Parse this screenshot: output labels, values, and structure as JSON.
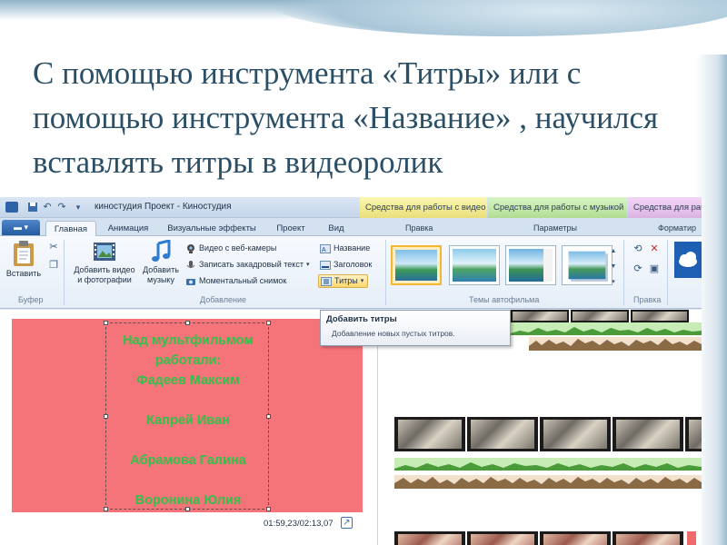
{
  "slide": {
    "text": "С помощью инструмента «Титры» или с помощью инструмента «Название» , научился вставлять титры в видеоролик"
  },
  "window": {
    "title": "киностудия Проект - Киностудия"
  },
  "context_tabs": {
    "video_tools": "Средства для работы с видео",
    "music_tools": "Средства для работы с музыкой",
    "text_tools": "Средства для работы с текстом"
  },
  "tabs": {
    "home": "Главная",
    "animation": "Анимация",
    "visual_effects": "Визуальные эффекты",
    "project": "Проект",
    "view": "Вид"
  },
  "context_group_labels": {
    "edit": "Правка",
    "params": "Параметры",
    "format": "Форматир"
  },
  "ribbon": {
    "paste_label": "Вставить",
    "add_video_label": "Добавить видео\nи фотографии",
    "add_music_label": "Добавить\nмузыку",
    "webcam_video": "Видео с веб-камеры",
    "record_narration": "Записать закадровый текст",
    "snapshot": "Моментальный снимок",
    "title": "Название",
    "caption": "Заголовок",
    "credits": "Титры",
    "group_clipboard": "Буфер",
    "group_add": "Добавление",
    "group_themes": "Темы автофильма",
    "group_edit": "Правка"
  },
  "tooltip": {
    "title": "Добавить титры",
    "description": "Добавление новых пустых титров."
  },
  "preview": {
    "credits_lines": [
      "Над мультфильмом",
      "работали:",
      "Фадеев Максим",
      "",
      "Капрей Иван",
      "",
      "Абрамова Галина",
      "",
      "Воронина Юлия"
    ],
    "time": "01:59,23/02:13,07"
  },
  "colors": {
    "accent": "#2a4f66",
    "preview_bg": "#f47479",
    "credits_text": "#32c14a",
    "ctx_video": "#f3ec98",
    "ctx_music": "#c7eaa9",
    "ctx_text": "#e8c6ed"
  },
  "icons": {
    "save": "save-icon",
    "undo": "undo-icon",
    "redo": "redo-icon",
    "paste": "clipboard-icon",
    "cut": "scissors-icon",
    "copy": "copy-icon",
    "add_video": "filmstrip-icon",
    "add_music": "music-note-icon",
    "webcam": "webcam-icon",
    "mic": "microphone-icon",
    "camera": "camera-icon",
    "title": "title-icon",
    "caption": "caption-icon",
    "credits": "credits-icon",
    "rotate": "rotate-icon",
    "delete": "delete-icon",
    "select_all": "select-all-icon",
    "skydrive": "cloud-icon",
    "fullscreen": "fullscreen-icon"
  }
}
